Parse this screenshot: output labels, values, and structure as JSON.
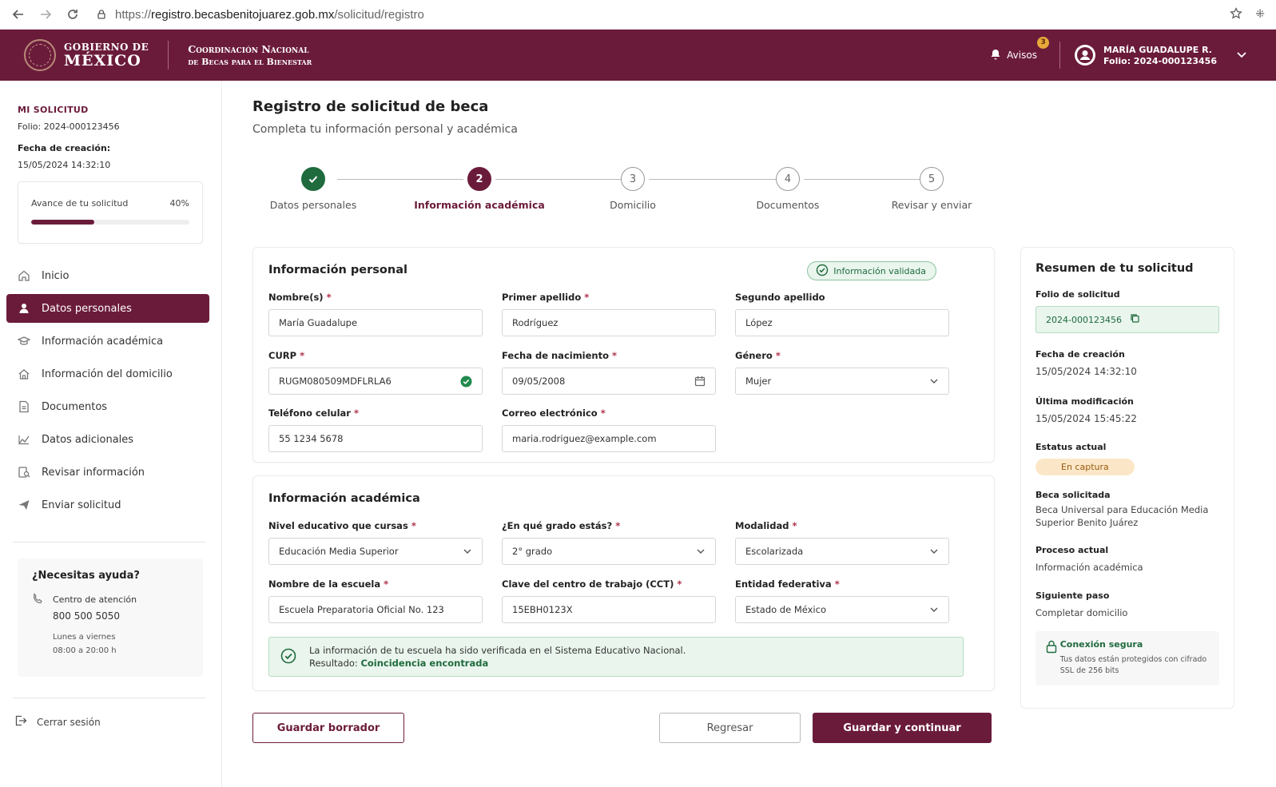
{
  "browser": {
    "url_scheme": "https://",
    "url_host": "registro.becasbenitojuarez.gob.mx",
    "url_path": "/solicitud/registro"
  },
  "header": {
    "logo_line1": "GOBIERNO DE",
    "logo_line2": "MÉXICO",
    "coord_line1": "Coordinación Nacional",
    "coord_line2": "de Becas para el Bienestar",
    "avisos_label": "Avisos",
    "avisos_count": "3",
    "user_name": "MARÍA GUADALUPE R.",
    "user_folio": "Folio: 2024-000123456"
  },
  "sidebar": {
    "section_title": "MI SOLICITUD",
    "folio": "Folio: 2024-000123456",
    "created_label": "Fecha de creación:",
    "created_value": "15/05/2024 14:32:10",
    "progress_label": "Avance de tu solicitud",
    "progress_percent": "40%",
    "progress_value": 0.4,
    "nav": [
      {
        "label": "Inicio",
        "icon": "home-icon"
      },
      {
        "label": "Datos personales",
        "icon": "user-icon"
      },
      {
        "label": "Información académica",
        "icon": "graduation-cap-icon"
      },
      {
        "label": "Información del domicilio",
        "icon": "house-icon"
      },
      {
        "label": "Documentos",
        "icon": "document-icon"
      },
      {
        "label": "Datos adicionales",
        "icon": "chart-icon"
      },
      {
        "label": "Revisar información",
        "icon": "review-icon"
      },
      {
        "label": "Enviar solicitud",
        "icon": "send-icon"
      }
    ],
    "help": {
      "title": "¿Necesitas ayuda?",
      "center_label": "Centro de atención",
      "center_phone": "800 500 5050",
      "days": "Lunes a viernes",
      "hours": "08:00 a 20:00 h"
    },
    "logout": "Cerrar sesión"
  },
  "main": {
    "title": "Registro de solicitud de beca",
    "subtitle": "Completa tu información personal y académica",
    "steps": [
      {
        "num": "1",
        "label": "Datos personales",
        "state": "done"
      },
      {
        "num": "2",
        "label": "Información académica",
        "state": "current"
      },
      {
        "num": "3",
        "label": "Domicilio",
        "state": "pending"
      },
      {
        "num": "4",
        "label": "Documentos",
        "state": "pending"
      },
      {
        "num": "5",
        "label": "Revisar y enviar",
        "state": "pending"
      }
    ],
    "personal": {
      "title": "Información personal",
      "validated": "Información validada",
      "fields": {
        "nombre": {
          "label": "Nombre(s)",
          "required": true,
          "value": "María Guadalupe"
        },
        "apellido1": {
          "label": "Primer apellido",
          "required": true,
          "value": "Rodríguez"
        },
        "apellido2": {
          "label": "Segundo apellido",
          "required": false,
          "value": "López"
        },
        "curp": {
          "label": "CURP",
          "required": true,
          "value": "RUGM080509MDFLRLA6"
        },
        "nacimiento": {
          "label": "Fecha de nacimiento",
          "required": true,
          "value": "09/05/2008"
        },
        "genero": {
          "label": "Género",
          "required": true,
          "value": "Mujer"
        },
        "telefono": {
          "label": "Teléfono celular",
          "required": true,
          "value": "55 1234 5678"
        },
        "correo": {
          "label": "Correo electrónico",
          "required": true,
          "value": "maria.rodriguez@example.com"
        }
      }
    },
    "academic": {
      "title": "Información académica",
      "fields": {
        "nivel": {
          "label": "Nivel educativo que cursas",
          "required": true,
          "value": "Educación Media Superior"
        },
        "grado": {
          "label": "¿En qué grado estás?",
          "required": true,
          "value": "2° grado"
        },
        "modalidad": {
          "label": "Modalidad",
          "required": true,
          "value": "Escolarizada"
        },
        "escuela": {
          "label": "Nombre de la escuela",
          "required": true,
          "value": "Escuela Preparatoria Oficial No. 123"
        },
        "cct": {
          "label": "Clave del centro de trabajo (CCT)",
          "required": true,
          "value": "15EBH0123X"
        },
        "entidad": {
          "label": "Entidad federativa",
          "required": true,
          "value": "Estado de México"
        }
      },
      "verify_text": "La información de tu escuela ha sido verificada en el Sistema Educativo Nacional.",
      "verify_result_label": "Resultado:",
      "verify_result_value": "Coincidencia encontrada"
    },
    "buttons": {
      "draft": "Guardar borrador",
      "back": "Regresar",
      "continue": "Guardar y continuar"
    }
  },
  "summary": {
    "title": "Resumen de tu solicitud",
    "folio_label": "Folio de solicitud",
    "folio_value": "2024-000123456",
    "created_label": "Fecha de creación",
    "created_value": "15/05/2024 14:32:10",
    "modified_label": "Última modificación",
    "modified_value": "15/05/2024 15:45:22",
    "status_label": "Estatus actual",
    "status_value": "En captura",
    "beca_label": "Beca solicitada",
    "beca_value": "Beca Universal para Educación Media Superior Benito Juárez",
    "process_label": "Proceso actual",
    "process_value": "Información académica",
    "next_label": "Siguiente paso",
    "next_value": "Completar domicilio",
    "secure_title": "Conexión segura",
    "secure_text": "Tus datos están protegidos con cifrado SSL de 256 bits"
  },
  "colors": {
    "brand": "#6b1b3a",
    "success": "#1f6b3e",
    "warning_bg": "#fbe7c7"
  }
}
